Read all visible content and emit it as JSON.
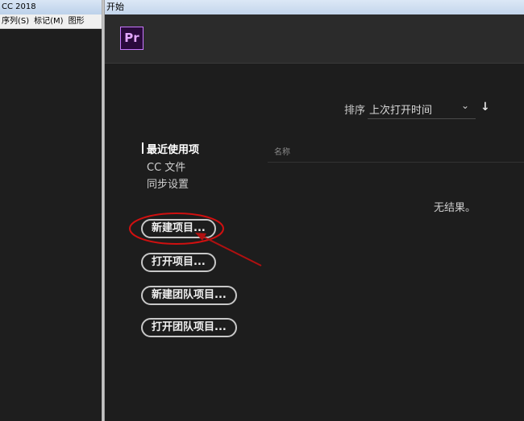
{
  "background_app": {
    "title": "CC 2018",
    "menu": [
      "序列(S)",
      "标记(M)",
      "图形"
    ]
  },
  "dialog": {
    "title": "开始",
    "logo": "Pr",
    "sort": {
      "label": "排序",
      "value": "上次打开时间"
    },
    "nav": {
      "recent": "最近使用项",
      "cc_files": "CC 文件",
      "sync": "同步设置"
    },
    "list": {
      "column_name": "名称",
      "empty": "无结果。"
    },
    "buttons": {
      "new_project": "新建项目...",
      "open_project": "打开项目...",
      "new_team_project": "新建团队项目...",
      "open_team_project": "打开团队项目..."
    }
  },
  "colors": {
    "logo_border": "#c878ff",
    "annotation": "#d01010"
  },
  "icons": {
    "sort_dropdown": "chevron-down-icon",
    "sort_direction": "arrow-down-icon"
  }
}
